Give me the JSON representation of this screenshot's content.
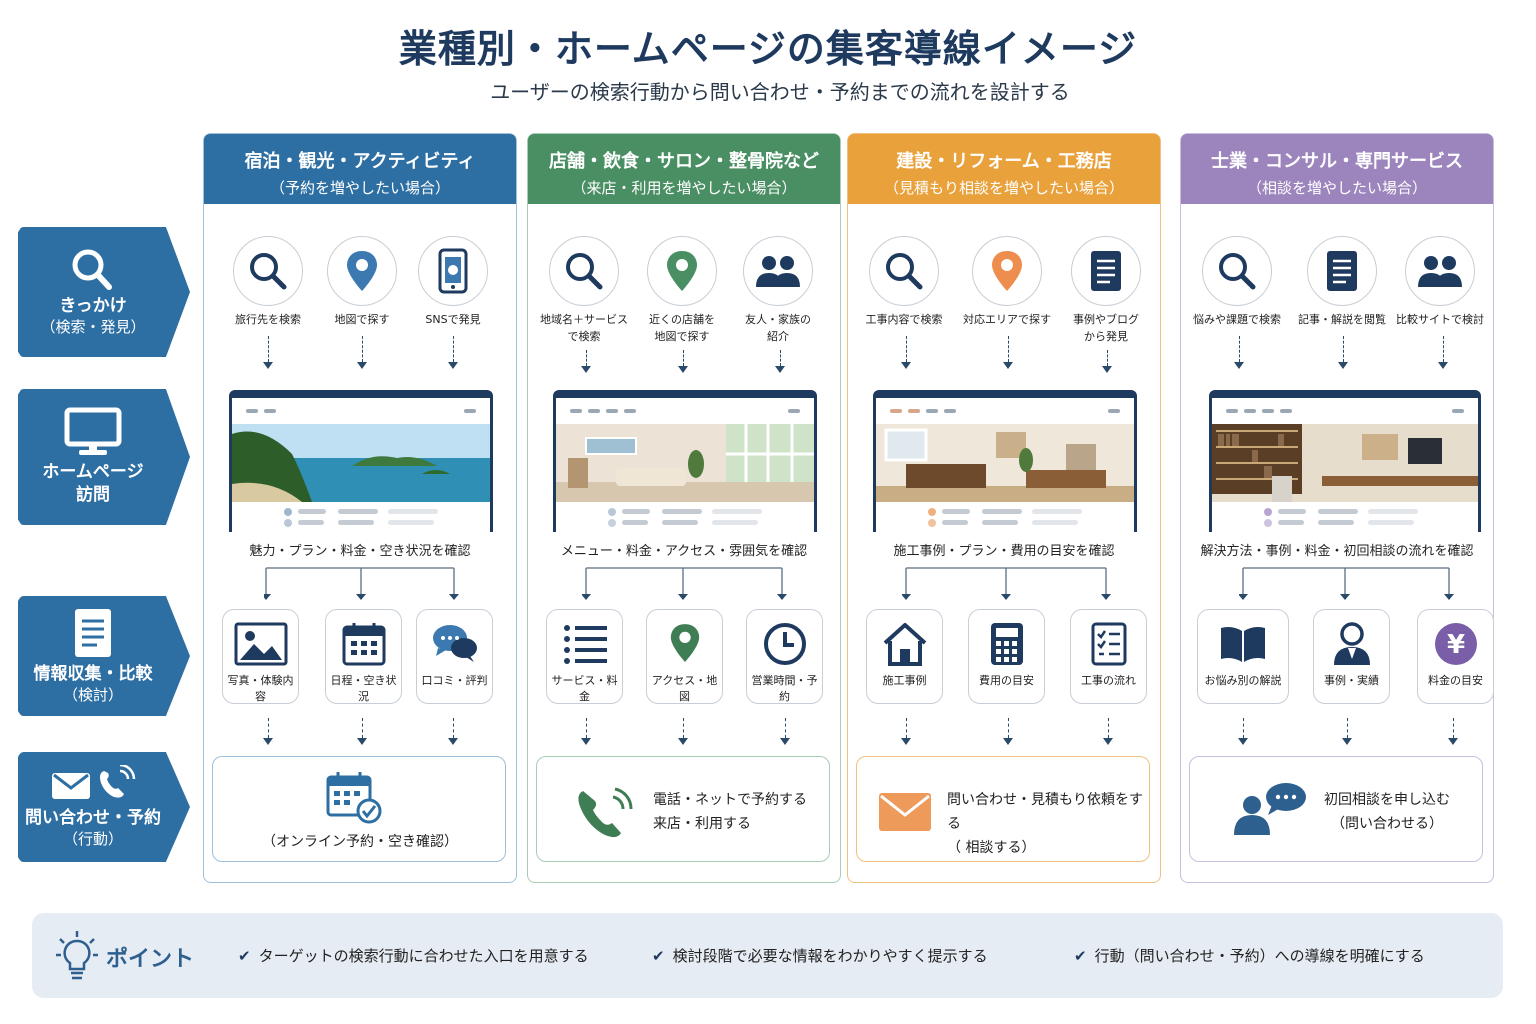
{
  "title": "業種別・ホームページの集客導線イメージ",
  "subtitle": "ユーザーの検索行動から問い合わせ・予約までの流れを設計する",
  "colors": {
    "blue": "#2d6ea3",
    "green": "#4a8f63",
    "orange": "#e9a13b",
    "purple": "#9c84bd",
    "navy": "#1f3a5f"
  },
  "stages": [
    {
      "label": "きっかけ",
      "sub": "（検索・発見）",
      "icon": "search-icon"
    },
    {
      "label": "ホームページ\n訪問",
      "sub": "",
      "icon": "monitor-icon"
    },
    {
      "label": "情報収集・比較",
      "sub": "（検討）",
      "icon": "document-icon"
    },
    {
      "label": "問い合わせ・予約",
      "sub": "（行動）",
      "icon": "mail-phone-icon"
    }
  ],
  "columns": [
    {
      "title": "宿泊・観光・アクティビティ",
      "subtitle": "（予約を増やしたい場合）",
      "triggers": [
        "旅行先を検索",
        "地図で探す",
        "SNSで発見"
      ],
      "check": "魅力・プラン・料金・空き状況を確認",
      "info": [
        "写真・体験内容",
        "日程・空き状況",
        "口コミ・評判"
      ],
      "action": "（オンライン予約・空き確認）"
    },
    {
      "title": "店舗・飲食・サロン・整骨院など",
      "subtitle": "（来店・利用を増やしたい場合）",
      "triggers": [
        "地域名＋サービス\nで検索",
        "近くの店舗を\n地図で探す",
        "友人・家族の\n紹介"
      ],
      "check": "メニュー・料金・アクセス・雰囲気を確認",
      "info": [
        "サービス・料金",
        "アクセス・地図",
        "営業時間・予約"
      ],
      "action": "電話・ネットで予約する\n来店・利用する"
    },
    {
      "title": "建設・リフォーム・工務店",
      "subtitle": "（見積もり相談を増やしたい場合）",
      "triggers": [
        "工事内容で検索",
        "対応エリアで探す",
        "事例やブログ\nから発見"
      ],
      "check": "施工事例・プラン・費用の目安を確認",
      "info": [
        "施工事例",
        "費用の目安",
        "工事の流れ"
      ],
      "action": "問い合わせ・見積もり依頼をする\n（ 相談する）"
    },
    {
      "title": "士業・コンサル・専門サービス",
      "subtitle": "（相談を増やしたい場合）",
      "triggers": [
        "悩みや課題で検索",
        "記事・解説を閲覧",
        "比較サイトで検討"
      ],
      "check": "解決方法・事例・料金・初回相談の流れを確認",
      "info": [
        "お悩み別の解説",
        "事例・実績",
        "料金の目安"
      ],
      "action": "初回相談を申し込む\n（問い合わせる）"
    }
  ],
  "point": {
    "label": "ポイント",
    "items": [
      "ターゲットの検索行動に合わせた入口を用意する",
      "検討段階で必要な情報をわかりやすく提示する",
      "行動（問い合わせ・予約）への導線を明確にする"
    ]
  }
}
